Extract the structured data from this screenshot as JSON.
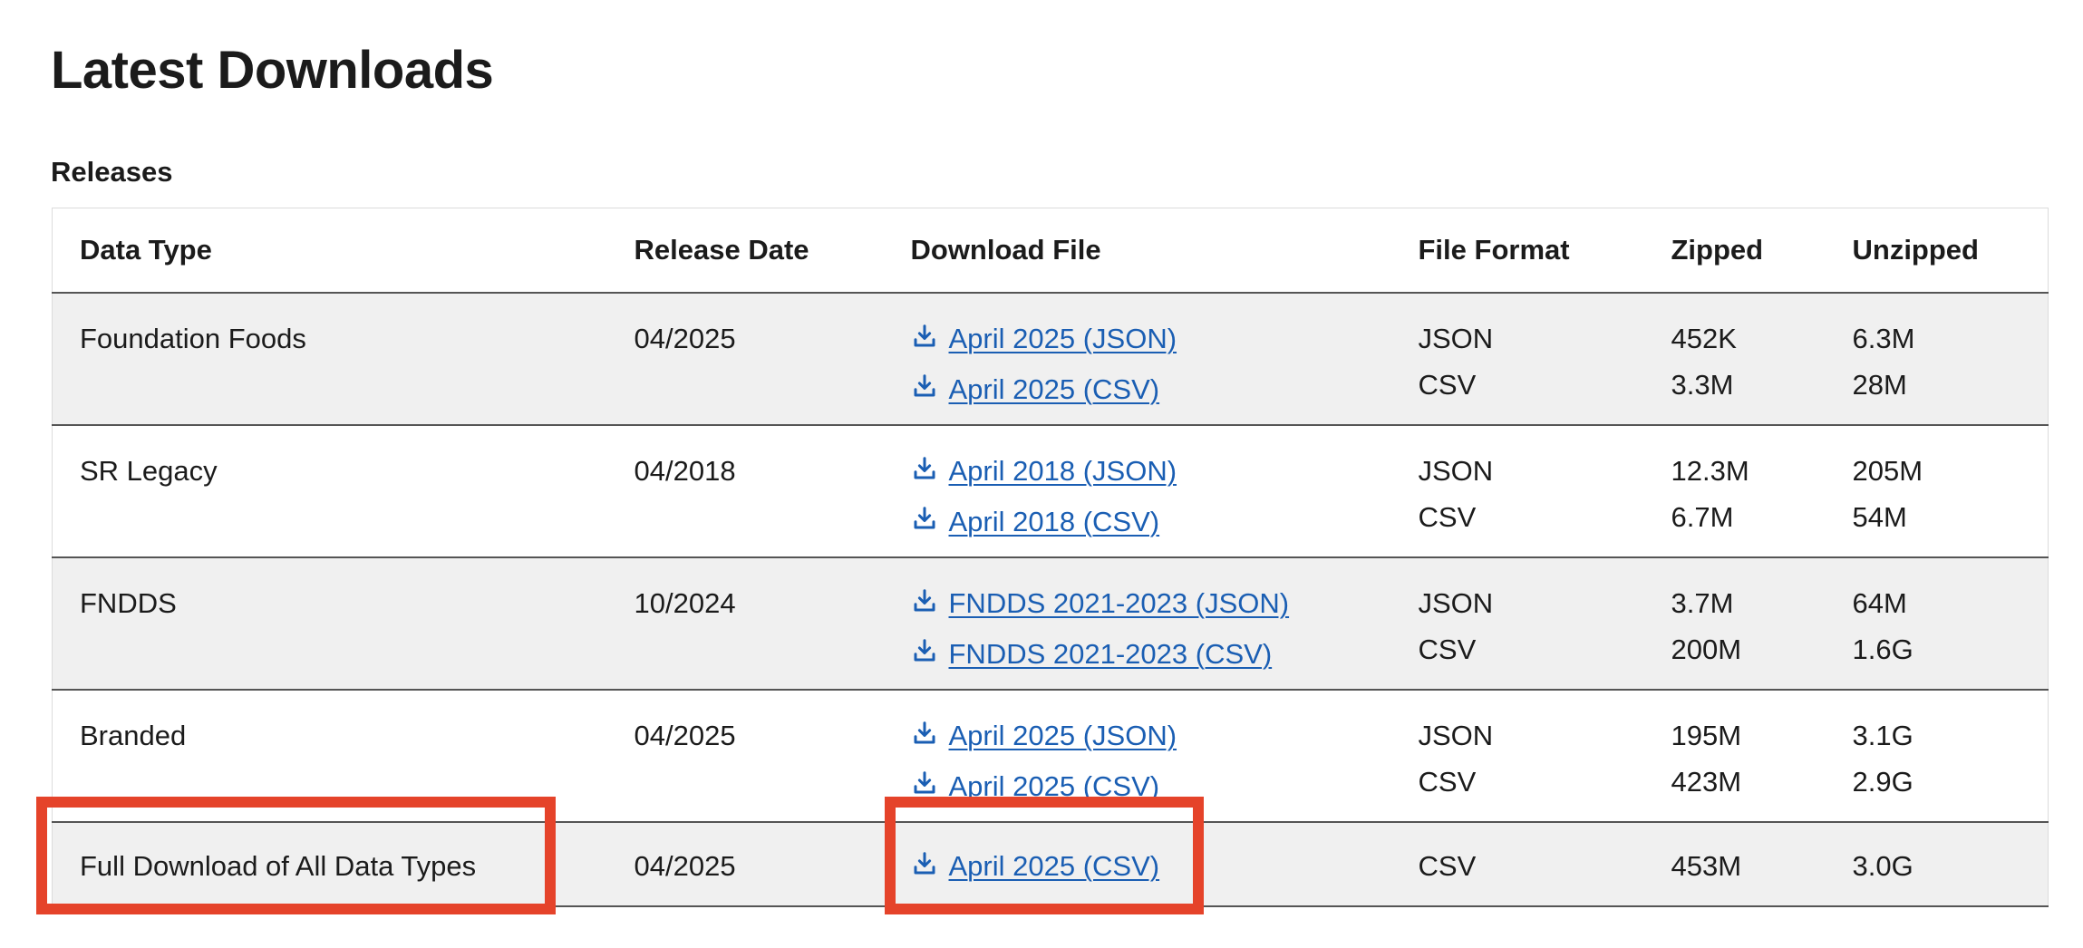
{
  "page": {
    "title": "Latest Downloads"
  },
  "table": {
    "caption": "Releases",
    "headers": {
      "data_type": "Data Type",
      "release_date": "Release Date",
      "download_file": "Download File",
      "file_format": "File Format",
      "zipped": "Zipped",
      "unzipped": "Unzipped"
    },
    "rows": [
      {
        "data_type": "Foundation Foods",
        "release_date": "04/2025",
        "files": [
          {
            "link": "April 2025 (JSON)",
            "format": "JSON",
            "zipped": "452K",
            "unzipped": "6.3M"
          },
          {
            "link": "April 2025 (CSV)",
            "format": "CSV",
            "zipped": "3.3M",
            "unzipped": "28M"
          }
        ]
      },
      {
        "data_type": "SR Legacy",
        "release_date": "04/2018",
        "files": [
          {
            "link": "April 2018 (JSON)",
            "format": "JSON",
            "zipped": "12.3M",
            "unzipped": "205M"
          },
          {
            "link": "April 2018 (CSV)",
            "format": "CSV",
            "zipped": "6.7M",
            "unzipped": "54M"
          }
        ]
      },
      {
        "data_type": "FNDDS",
        "release_date": "10/2024",
        "files": [
          {
            "link": "FNDDS 2021-2023 (JSON)",
            "format": "JSON",
            "zipped": "3.7M",
            "unzipped": "64M"
          },
          {
            "link": "FNDDS 2021-2023 (CSV)",
            "format": "CSV",
            "zipped": "200M",
            "unzipped": "1.6G"
          }
        ]
      },
      {
        "data_type": "Branded",
        "release_date": "04/2025",
        "files": [
          {
            "link": "April 2025 (JSON)",
            "format": "JSON",
            "zipped": "195M",
            "unzipped": "3.1G"
          },
          {
            "link": "April 2025 (CSV)",
            "format": "CSV",
            "zipped": "423M",
            "unzipped": "2.9G"
          }
        ]
      },
      {
        "data_type": "Full Download of All Data Types",
        "release_date": "04/2025",
        "files": [
          {
            "link": "April 2025 (CSV)",
            "format": "CSV",
            "zipped": "453M",
            "unzipped": "3.0G"
          }
        ]
      }
    ]
  },
  "icons": {
    "download": "download-icon"
  },
  "colors": {
    "link": "#1a5eb3",
    "row_shade": "#f0f0f0",
    "highlight": "#e5432a",
    "row_border": "#555555"
  }
}
